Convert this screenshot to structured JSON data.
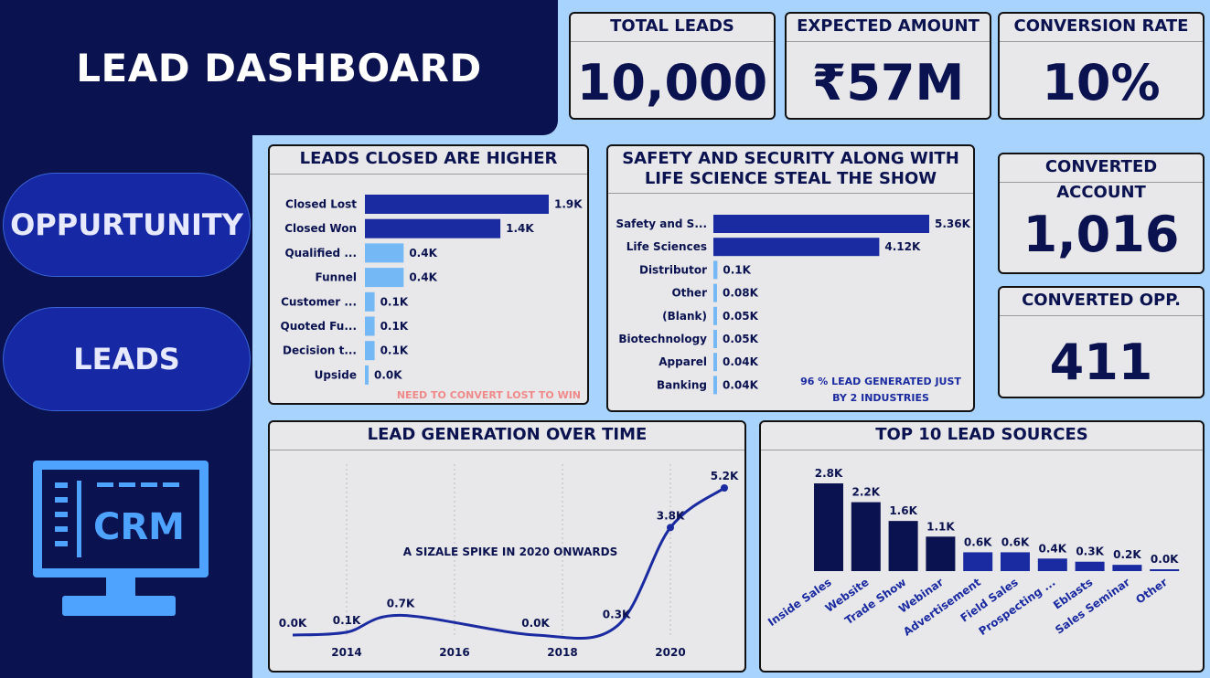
{
  "header": {
    "title": "LEAD DASHBOARD"
  },
  "nav": {
    "opportunity": "OPPURTUNITY",
    "leads": "LEADS"
  },
  "logo": {
    "text": "CRM",
    "icon": "monitor-icon"
  },
  "kpis": {
    "total_leads": {
      "label": "TOTAL LEADS",
      "value": "10,000"
    },
    "expected_amount": {
      "label": "EXPECTED AMOUNT",
      "value": "₹57M"
    },
    "conversion_rate": {
      "label": "CONVERSION RATE",
      "value": "10%"
    },
    "converted_account": {
      "label": "CONVERTED ACCOUNT",
      "value": "1,016"
    },
    "converted_opp": {
      "label": "CONVERTED OPP.",
      "value": "411"
    }
  },
  "colors": {
    "dark_navy": "#0b1250",
    "navy_bar": "#1a2aa0",
    "light_bar": "#74b8f5",
    "annotation_red": "#f08a8a",
    "background": "#a8d3ff"
  },
  "chart_data": [
    {
      "id": "stage",
      "type": "bar",
      "orientation": "horizontal",
      "title": "LEADS CLOSED ARE HIGHER",
      "categories": [
        "Closed Lost",
        "Closed Won",
        "Qualified ...",
        "Funnel",
        "Customer ...",
        "Quoted Fu...",
        "Decision t...",
        "Upside"
      ],
      "values": [
        1.9,
        1.4,
        0.4,
        0.4,
        0.1,
        0.1,
        0.1,
        0.0
      ],
      "labels": [
        "1.9K",
        "1.4K",
        "0.4K",
        "0.4K",
        "0.1K",
        "0.1K",
        "0.1K",
        "0.0K"
      ],
      "unit": "K",
      "annotation": "NEED TO CONVERT LOST TO WIN"
    },
    {
      "id": "industry",
      "type": "bar",
      "orientation": "horizontal",
      "title": "SAFETY AND SECURITY ALONG WITH LIFE SCIENCE STEAL THE SHOW",
      "categories": [
        "Safety and S...",
        "Life Sciences",
        "Distributor",
        "Other",
        "(Blank)",
        "Biotechnology",
        "Apparel",
        "Banking"
      ],
      "values": [
        5.36,
        4.12,
        0.1,
        0.08,
        0.05,
        0.05,
        0.04,
        0.04
      ],
      "labels": [
        "5.36K",
        "4.12K",
        "0.1K",
        "0.08K",
        "0.05K",
        "0.05K",
        "0.04K",
        "0.04K"
      ],
      "unit": "K",
      "annotation": [
        "96 % LEAD GENERATED JUST",
        "BY 2 INDUSTRIES"
      ]
    },
    {
      "id": "time",
      "type": "line",
      "title": "LEAD GENERATION OVER TIME",
      "x": [
        2013,
        2014,
        2015,
        2017.5,
        2019,
        2020,
        2021
      ],
      "y": [
        0.0,
        0.1,
        0.7,
        0.0,
        0.3,
        3.8,
        5.2
      ],
      "labels": [
        "0.0K",
        "0.1K",
        "0.7K",
        "0.0K",
        "0.3K",
        "3.8K",
        "5.2K"
      ],
      "xticks": [
        "2014",
        "2016",
        "2018",
        "2020"
      ],
      "xtick_values": [
        2014,
        2016,
        2018,
        2020
      ],
      "unit": "K",
      "annotation": "A SIZALE SPIKE IN 2020 ONWARDS"
    },
    {
      "id": "sources",
      "type": "bar",
      "title": "TOP 10 LEAD SOURCES",
      "categories": [
        "Inside Sales",
        "Website",
        "Trade Show",
        "Webinar",
        "Advertisement",
        "Field Sales",
        "Prospecting ...",
        "Eblasts",
        "Sales Seminar",
        "Other"
      ],
      "values": [
        2.8,
        2.2,
        1.6,
        1.1,
        0.6,
        0.6,
        0.4,
        0.3,
        0.2,
        0.0
      ],
      "labels": [
        "2.8K",
        "2.2K",
        "1.6K",
        "1.1K",
        "0.6K",
        "0.6K",
        "0.4K",
        "0.3K",
        "0.2K",
        "0.0K"
      ],
      "unit": "K"
    }
  ]
}
